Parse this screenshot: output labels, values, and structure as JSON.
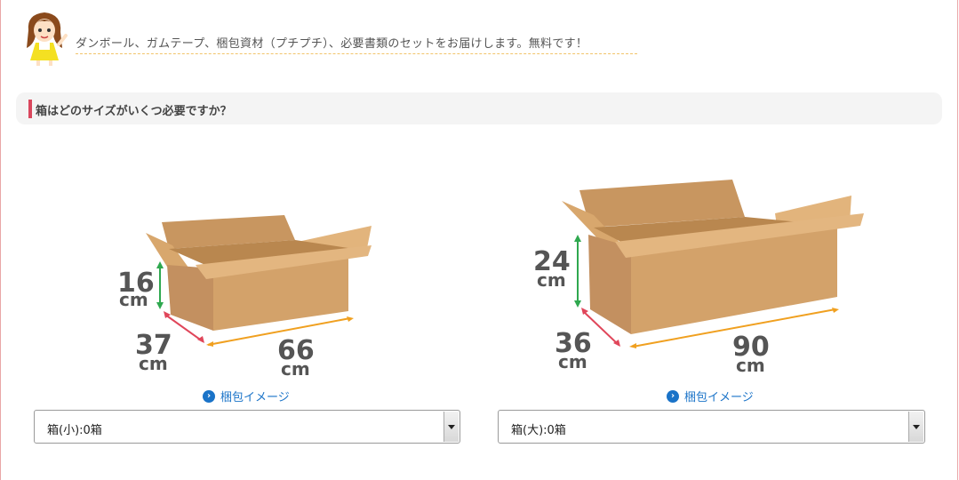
{
  "intro_text": "ダンボール、ガムテープ、梱包資材（プチプチ）、必要書類のセットをお届けします。無料です！",
  "section_title": "箱はどのサイズがいくつ必要ですか？",
  "boxes": [
    {
      "height": "16",
      "height_unit": "cm",
      "depth": "37",
      "depth_unit": "cm",
      "width": "66",
      "width_unit": "cm",
      "link_label": "梱包イメージ",
      "select_value": "箱(小):0箱"
    },
    {
      "height": "24",
      "height_unit": "cm",
      "depth": "36",
      "depth_unit": "cm",
      "width": "90",
      "width_unit": "cm",
      "link_label": "梱包イメージ",
      "select_value": "箱(大):0箱"
    }
  ],
  "colors": {
    "frame": "#e9a7a7",
    "accent_bar": "#d9475d",
    "link": "#1a73c8",
    "cardboard": "#d6a86e",
    "height_arrow": "#2fa84f",
    "depth_arrow": "#e0465a",
    "width_arrow": "#f0a020"
  }
}
